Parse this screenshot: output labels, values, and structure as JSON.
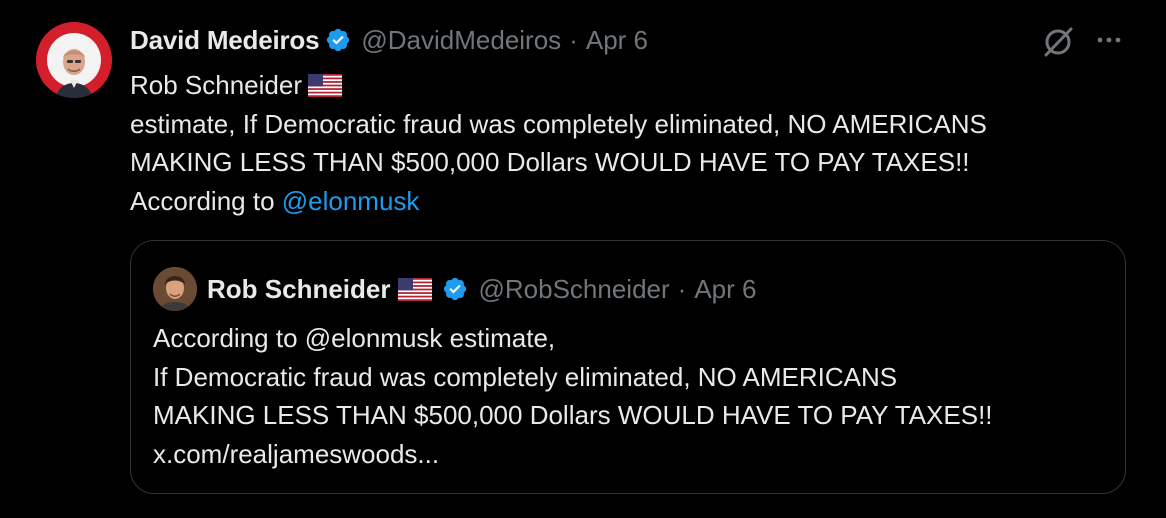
{
  "tweet": {
    "author_name": "David Medeiros",
    "author_handle": "@DavidMedeiros",
    "separator": "·",
    "date": "Apr 6",
    "text_line1": "Rob Schneider",
    "text_line2": "estimate, If Democratic fraud was completely eliminated, NO AMERICANS",
    "text_line3": "MAKING LESS THAN $500,000 Dollars WOULD HAVE TO PAY TAXES!!",
    "text_line4_prefix": "According to ",
    "text_line4_mention": "@elonmusk"
  },
  "quote": {
    "author_name": "Rob Schneider",
    "author_handle": "@RobSchneider",
    "separator": "·",
    "date": "Apr 6",
    "line1": "According to @elonmusk estimate,",
    "line2": "If Democratic fraud was completely eliminated, NO AMERICANS",
    "line3": "MAKING LESS THAN $500,000 Dollars WOULD HAVE TO PAY TAXES!!",
    "line4": "x.com/realjameswoods..."
  },
  "icons": {
    "verified": "verified-badge-icon",
    "flag": "us-flag-icon",
    "grok": "grok-icon",
    "more": "more-options-icon"
  },
  "colors": {
    "background": "#000000",
    "text": "#e7e9ea",
    "secondary": "#71767b",
    "link": "#1d9bf0",
    "verified": "#1d9bf0",
    "border": "#2f3336"
  }
}
